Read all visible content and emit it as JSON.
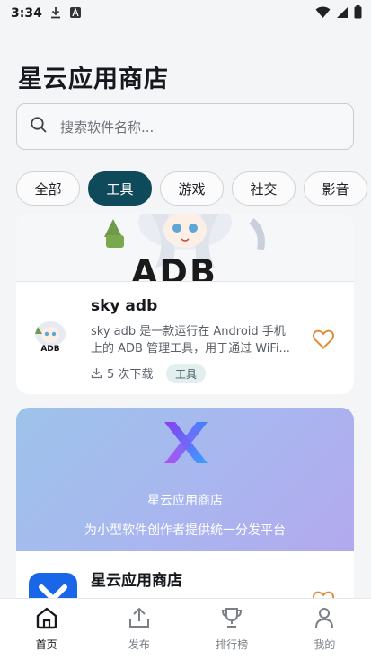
{
  "status_bar": {
    "time": "3:34"
  },
  "header": {
    "title": "星云应用商店"
  },
  "search": {
    "placeholder": "搜索软件名称..."
  },
  "categories": [
    {
      "label": "全部",
      "active": false
    },
    {
      "label": "工具",
      "active": true
    },
    {
      "label": "游戏",
      "active": false
    },
    {
      "label": "社交",
      "active": false
    },
    {
      "label": "影音",
      "active": false
    }
  ],
  "apps": [
    {
      "banner_text": "ADB",
      "icon_text": "ADB",
      "name": "sky adb",
      "desc_line1": "sky adb 是一款运行在 Android 手机",
      "desc_line2": "上的 ADB 管理工具，用于通过 WiFi...",
      "downloads": "5 次下载",
      "tag": "工具"
    },
    {
      "promo_title": "星云应用商店",
      "promo_subtitle": "为小型软件创作者提供统一分发平台",
      "name": "星云应用商店"
    }
  ],
  "nav": {
    "home": "首页",
    "publish": "发布",
    "ranking": "排行榜",
    "mine": "我的"
  },
  "colors": {
    "accent": "#0e4a5a",
    "favorite": "#e38a3a",
    "tag_bg": "#e2efee",
    "promo_gradient_start": "#9dc3ea",
    "promo_gradient_end": "#b3a9ee"
  }
}
